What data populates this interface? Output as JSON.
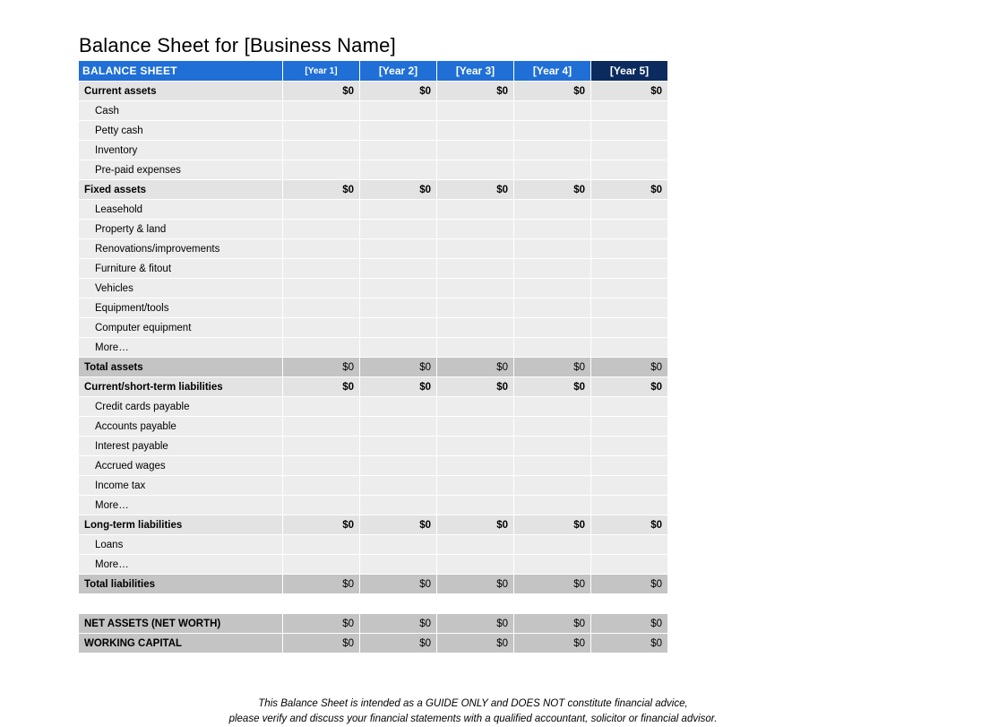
{
  "title": "Balance Sheet for [Business Name]",
  "header": {
    "label": "BALANCE SHEET",
    "years": [
      "[Year 1]",
      "[Year 2]",
      "[Year 3]",
      "[Year 4]",
      "[Year 5]"
    ]
  },
  "sections": {
    "current_assets": {
      "label": "Current assets",
      "values": [
        "$0",
        "$0",
        "$0",
        "$0",
        "$0"
      ],
      "items": [
        {
          "label": "Cash",
          "values": [
            "",
            "",
            "",
            "",
            ""
          ]
        },
        {
          "label": "Petty cash",
          "values": [
            "",
            "",
            "",
            "",
            ""
          ]
        },
        {
          "label": "Inventory",
          "values": [
            "",
            "",
            "",
            "",
            ""
          ]
        },
        {
          "label": "Pre-paid expenses",
          "values": [
            "",
            "",
            "",
            "",
            ""
          ]
        }
      ]
    },
    "fixed_assets": {
      "label": "Fixed assets",
      "values": [
        "$0",
        "$0",
        "$0",
        "$0",
        "$0"
      ],
      "items": [
        {
          "label": "Leasehold",
          "values": [
            "",
            "",
            "",
            "",
            ""
          ]
        },
        {
          "label": "Property & land",
          "values": [
            "",
            "",
            "",
            "",
            ""
          ]
        },
        {
          "label": "Renovations/improvements",
          "values": [
            "",
            "",
            "",
            "",
            ""
          ]
        },
        {
          "label": "Furniture & fitout",
          "values": [
            "",
            "",
            "",
            "",
            ""
          ]
        },
        {
          "label": "Vehicles",
          "values": [
            "",
            "",
            "",
            "",
            ""
          ]
        },
        {
          "label": "Equipment/tools",
          "values": [
            "",
            "",
            "",
            "",
            ""
          ]
        },
        {
          "label": "Computer equipment",
          "values": [
            "",
            "",
            "",
            "",
            ""
          ]
        },
        {
          "label": "More…",
          "values": [
            "",
            "",
            "",
            "",
            ""
          ]
        }
      ]
    },
    "total_assets": {
      "label": "Total assets",
      "values": [
        "$0",
        "$0",
        "$0",
        "$0",
        "$0"
      ]
    },
    "current_liabilities": {
      "label": "Current/short-term liabilities",
      "values": [
        "$0",
        "$0",
        "$0",
        "$0",
        "$0"
      ],
      "items": [
        {
          "label": "Credit cards payable",
          "values": [
            "",
            "",
            "",
            "",
            ""
          ]
        },
        {
          "label": "Accounts payable",
          "values": [
            "",
            "",
            "",
            "",
            ""
          ]
        },
        {
          "label": "Interest payable",
          "values": [
            "",
            "",
            "",
            "",
            ""
          ]
        },
        {
          "label": "Accrued wages",
          "values": [
            "",
            "",
            "",
            "",
            ""
          ]
        },
        {
          "label": "Income tax",
          "values": [
            "",
            "",
            "",
            "",
            ""
          ]
        },
        {
          "label": "More…",
          "values": [
            "",
            "",
            "",
            "",
            ""
          ]
        }
      ]
    },
    "long_term_liabilities": {
      "label": "Long-term liabilities",
      "values": [
        "$0",
        "$0",
        "$0",
        "$0",
        "$0"
      ],
      "items": [
        {
          "label": "Loans",
          "values": [
            "",
            "",
            "",
            "",
            ""
          ]
        },
        {
          "label": "More…",
          "values": [
            "",
            "",
            "",
            "",
            ""
          ]
        }
      ]
    },
    "total_liabilities": {
      "label": "Total liabilities",
      "values": [
        "$0",
        "$0",
        "$0",
        "$0",
        "$0"
      ]
    },
    "net_assets": {
      "label": "NET ASSETS (NET WORTH)",
      "values": [
        "$0",
        "$0",
        "$0",
        "$0",
        "$0"
      ]
    },
    "working_capital": {
      "label": "WORKING CAPITAL",
      "values": [
        "$0",
        "$0",
        "$0",
        "$0",
        "$0"
      ]
    }
  },
  "disclaimer": {
    "line1": "This Balance Sheet is intended as a GUIDE ONLY and DOES NOT constitute financial advice,",
    "line2": "please verify and discuss your financial statements with a qualified accountant, solicitor or financial advisor."
  }
}
